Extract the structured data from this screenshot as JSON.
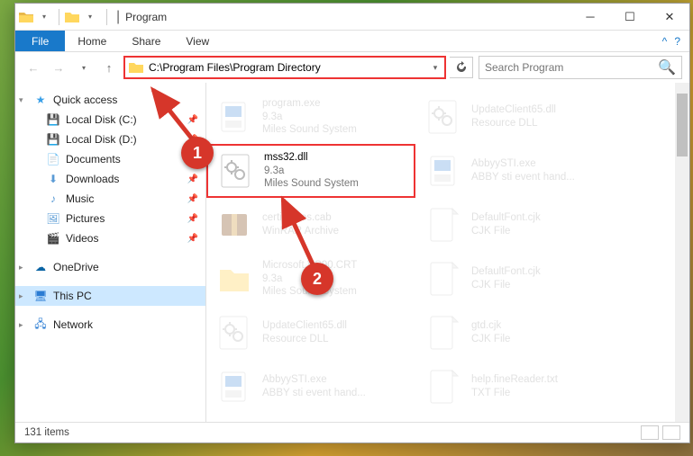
{
  "window": {
    "title": "Program"
  },
  "tabs": {
    "file": "File",
    "home": "Home",
    "share": "Share",
    "view": "View"
  },
  "address": {
    "path": "C:\\Program Files\\Program Directory"
  },
  "search": {
    "placeholder": "Search Program"
  },
  "sidebar": {
    "quick": "Quick access",
    "items": [
      {
        "label": "Local Disk (C:)"
      },
      {
        "label": "Local Disk (D:)"
      },
      {
        "label": "Documents"
      },
      {
        "label": "Downloads"
      },
      {
        "label": "Music"
      },
      {
        "label": "Pictures"
      },
      {
        "label": "Videos"
      }
    ],
    "onedrive": "OneDrive",
    "thispc": "This PC",
    "network": "Network"
  },
  "files": [
    {
      "name": "program.exe",
      "sub1": "9.3a",
      "sub2": "Miles Sound System",
      "faded": true,
      "hl": false,
      "icon": "exe"
    },
    {
      "name": "mss32.dll",
      "sub1": "9.3a",
      "sub2": "Miles Sound System",
      "faded": false,
      "hl": true,
      "icon": "dll"
    },
    {
      "name": "certificates.cab",
      "sub1": "WinRAR Archive",
      "sub2": "",
      "faded": true,
      "hl": false,
      "icon": "cab"
    },
    {
      "name": "Microsoft.VC90.CRT",
      "sub1": "9.3a",
      "sub2": "Miles Sound System",
      "faded": true,
      "hl": false,
      "icon": "folder"
    },
    {
      "name": "UpdateClient65.dll",
      "sub1": "Resource DLL",
      "sub2": "",
      "faded": true,
      "hl": false,
      "icon": "dll"
    },
    {
      "name": "AbbyySTI.exe",
      "sub1": "ABBY sti event hand...",
      "sub2": "",
      "faded": true,
      "hl": false,
      "icon": "exe"
    },
    {
      "name": "UpdateClient65.dll",
      "sub1": "Resource DLL",
      "sub2": "",
      "faded": true,
      "hl": false,
      "icon": "dll"
    },
    {
      "name": "AbbyySTI.exe",
      "sub1": "ABBY sti event hand...",
      "sub2": "",
      "faded": true,
      "hl": false,
      "icon": "exe"
    },
    {
      "name": "DefaultFont.cjk",
      "sub1": "CJK File",
      "sub2": "",
      "faded": true,
      "hl": false,
      "icon": "file"
    },
    {
      "name": "DefaultFont.cjk",
      "sub1": "CJK File",
      "sub2": "",
      "faded": true,
      "hl": false,
      "icon": "file"
    },
    {
      "name": "gtd.cjk",
      "sub1": "CJK File",
      "sub2": "",
      "faded": true,
      "hl": false,
      "icon": "file"
    },
    {
      "name": "help.fineReader.txt",
      "sub1": "TXT File",
      "sub2": "",
      "faded": true,
      "hl": false,
      "icon": "file"
    }
  ],
  "status": {
    "items": "131 items"
  },
  "callouts": {
    "c1": "1",
    "c2": "2"
  }
}
